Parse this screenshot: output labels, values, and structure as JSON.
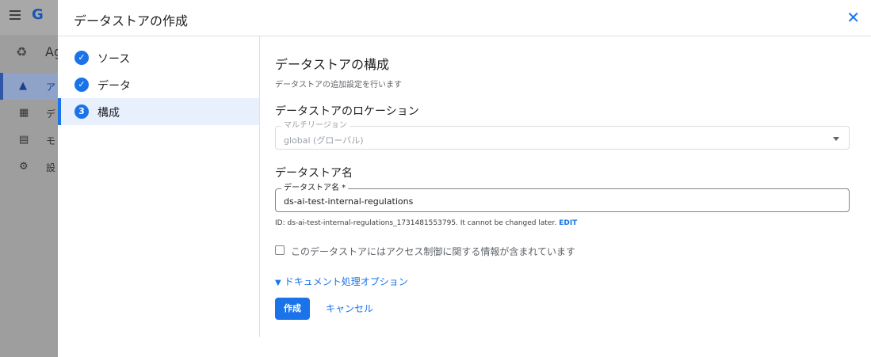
{
  "background_app": {
    "logo_letter": "G",
    "product_text": "Ag",
    "nav_items": [
      {
        "icon": "apps-hub-icon",
        "label": "ア",
        "active": true
      },
      {
        "icon": "table-icon",
        "label": "デ",
        "active": false
      },
      {
        "icon": "monitor-icon",
        "label": "モ",
        "active": false
      },
      {
        "icon": "gear-icon",
        "label": "設",
        "active": false
      }
    ]
  },
  "dialog": {
    "title": "データストアの作成",
    "close_icon": "close-icon"
  },
  "stepper": {
    "steps": [
      {
        "label": "ソース",
        "state": "done"
      },
      {
        "label": "データ",
        "state": "done"
      },
      {
        "label": "構成",
        "state": "active",
        "number": "3"
      }
    ]
  },
  "content": {
    "heading": "データストアの構成",
    "subheading": "データストアの追加設定を行います",
    "location": {
      "section_title": "データストアのロケーション",
      "field_label": "マルチリージョン",
      "value": "global (グローバル)"
    },
    "name": {
      "section_title": "データストア名",
      "field_label": "データストア名 *",
      "value": "ds-ai-test-internal-regulations",
      "id_text": "ID: ds-ai-test-internal-regulations_1731481553795. It cannot be changed later.",
      "edit_label": "EDIT"
    },
    "access_control_checkbox": {
      "label": "このデータストアにはアクセス制御に関する情報が含まれています",
      "checked": false
    },
    "doc_processing_expander": "ドキュメント処理オプション",
    "create_button": "作成",
    "cancel_button": "キャンセル"
  },
  "colors": {
    "accent": "#1a73e8",
    "overlay": "#9e9e9e"
  }
}
